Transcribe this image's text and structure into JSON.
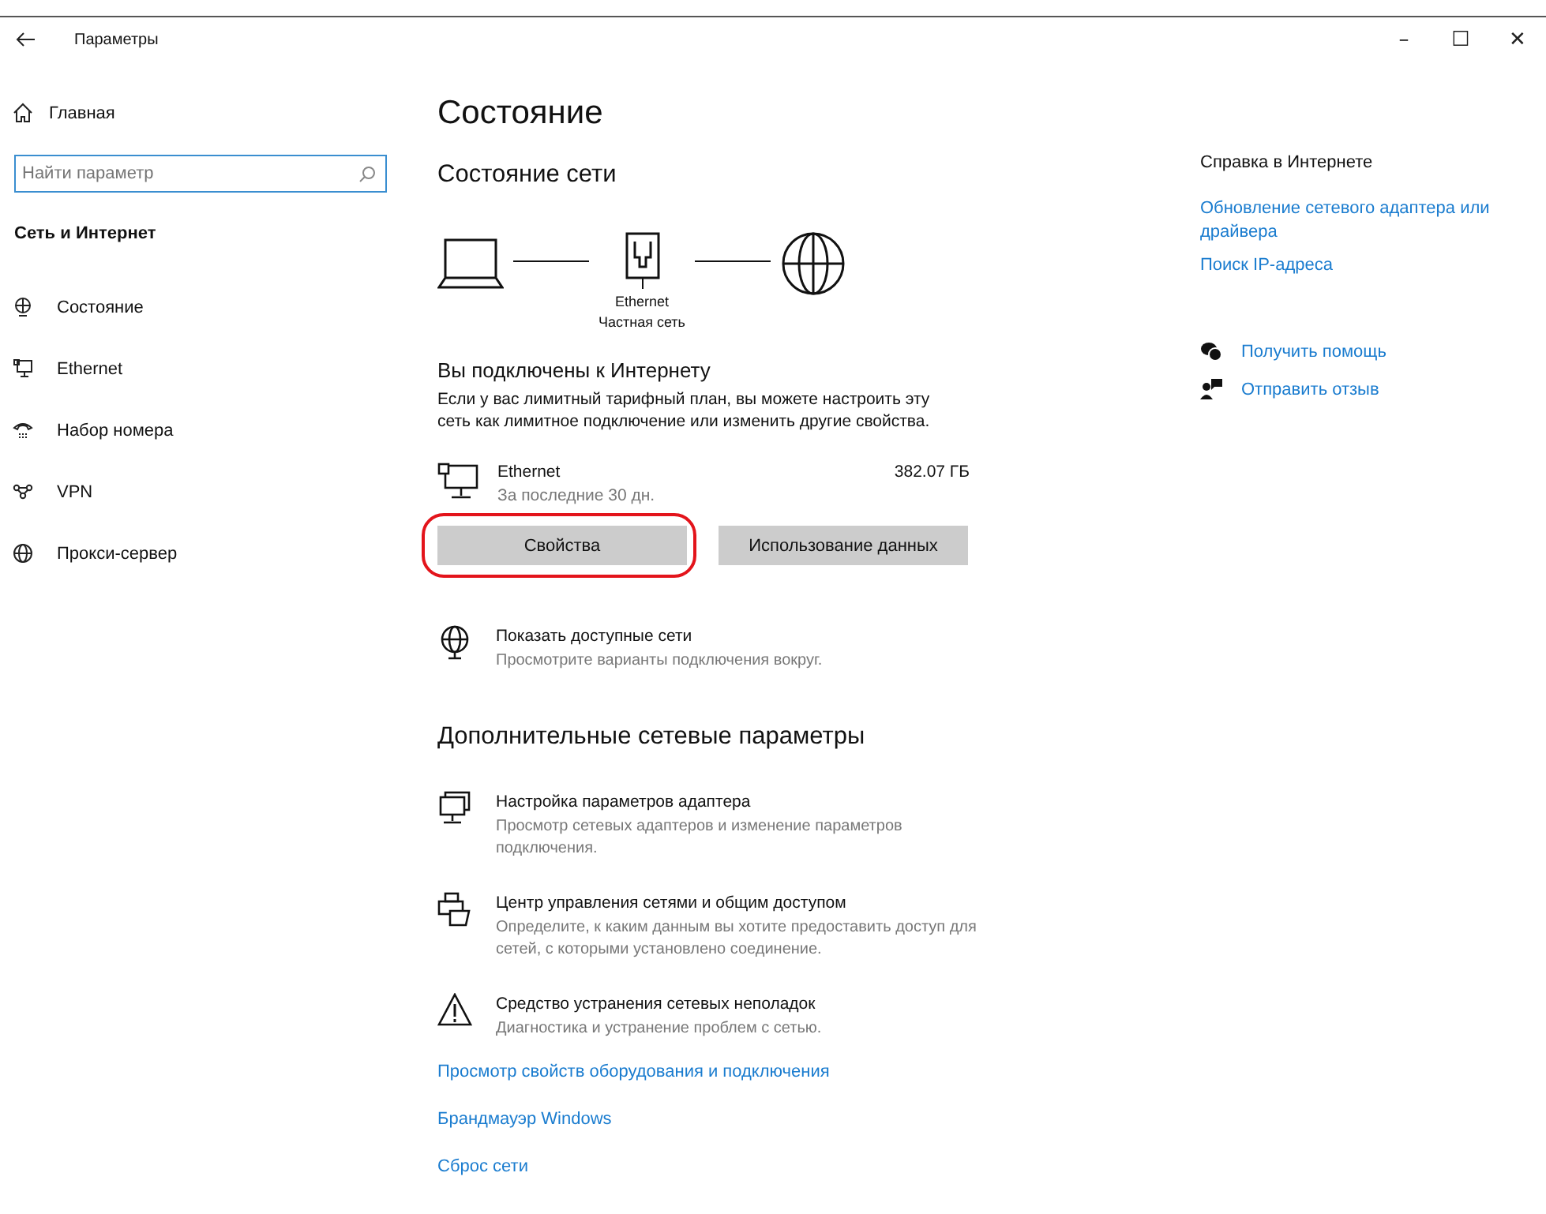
{
  "window": {
    "title": "Параметры",
    "controls": [
      "–",
      "☐",
      "✕"
    ]
  },
  "sidebar": {
    "home": "Главная",
    "search": {
      "placeholder": "Найти параметр"
    },
    "section": "Сеть и Интернет",
    "items": [
      {
        "label": "Состояние"
      },
      {
        "label": "Ethernet"
      },
      {
        "label": "Набор номера"
      },
      {
        "label": "VPN"
      },
      {
        "label": "Прокси-сервер"
      }
    ]
  },
  "main": {
    "title": "Состояние",
    "subtitle": "Состояние сети",
    "diagram": {
      "adapter": "Ethernet",
      "network": "Частная сеть"
    },
    "connected": {
      "heading": "Вы подключены к Интернету",
      "text": "Если у вас лимитный тарифный план, вы можете настроить эту сеть как лимитное подключение или изменить другие свойства."
    },
    "usage": {
      "name": "Ethernet",
      "period": "За последние 30 дн.",
      "amount": "382.07 ГБ"
    },
    "buttons": [
      {
        "label": "Свойства",
        "highlighted": true
      },
      {
        "label": "Использование данных",
        "highlighted": false
      }
    ],
    "show_networks": {
      "title": "Показать доступные сети",
      "text": "Просмотрите варианты подключения вокруг."
    },
    "advanced_heading": "Дополнительные сетевые параметры",
    "advanced": [
      {
        "title": "Настройка параметров адаптера",
        "text": "Просмотр сетевых адаптеров и изменение параметров подключения."
      },
      {
        "title": "Центр управления сетями и общим доступом",
        "text": "Определите, к каким данным вы хотите предоставить доступ для сетей, с которыми установлено соединение."
      },
      {
        "title": "Средство устранения сетевых неполадок",
        "text": "Диагностика и устранение проблем с сетью."
      }
    ],
    "links": [
      "Просмотр свойств оборудования и подключения",
      "Брандмауэр Windows",
      "Сброс сети"
    ]
  },
  "help": {
    "heading": "Справка в Интернете",
    "links": [
      "Обновление сетевого адаптера или драйвера",
      "Поиск IP-адреса"
    ],
    "actions": [
      "Получить помощь",
      "Отправить отзыв"
    ]
  }
}
